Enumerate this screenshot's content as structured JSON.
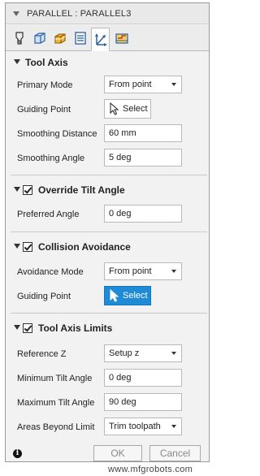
{
  "dialog": {
    "title": "PARALLEL : PARALLEL3"
  },
  "tabs": [
    {
      "icon": "tool-icon"
    },
    {
      "icon": "geometry-icon"
    },
    {
      "icon": "heights-icon"
    },
    {
      "icon": "passes-icon"
    },
    {
      "icon": "axis-icon",
      "active": true
    },
    {
      "icon": "linking-icon"
    }
  ],
  "tool_axis": {
    "header": "Tool Axis",
    "primary_mode_label": "Primary Mode",
    "primary_mode_value": "From point",
    "guiding_point_label": "Guiding Point",
    "guiding_point_button": "Select",
    "smoothing_distance_label": "Smoothing Distance",
    "smoothing_distance_value": "60 mm",
    "smoothing_angle_label": "Smoothing Angle",
    "smoothing_angle_value": "5 deg"
  },
  "override_tilt": {
    "header": "Override Tilt Angle",
    "preferred_angle_label": "Preferred Angle",
    "preferred_angle_value": "0 deg"
  },
  "collision": {
    "header": "Collision Avoidance",
    "avoidance_mode_label": "Avoidance Mode",
    "avoidance_mode_value": "From point",
    "guiding_point_label": "Guiding Point",
    "guiding_point_button": "Select"
  },
  "limits": {
    "header": "Tool Axis Limits",
    "reference_z_label": "Reference Z",
    "reference_z_value": "Setup z",
    "min_tilt_label": "Minimum Tilt Angle",
    "min_tilt_value": "0 deg",
    "max_tilt_label": "Maximum Tilt Angle",
    "max_tilt_value": "90 deg",
    "areas_beyond_label": "Areas Beyond Limit",
    "areas_beyond_value": "Trim toolpath"
  },
  "footer": {
    "info": "i",
    "ok": "OK",
    "cancel": "Cancel"
  },
  "watermark": "www.mfgrobots.com",
  "colors": {
    "accent": "#1f8bd6",
    "panel": "#f2f2f2"
  }
}
